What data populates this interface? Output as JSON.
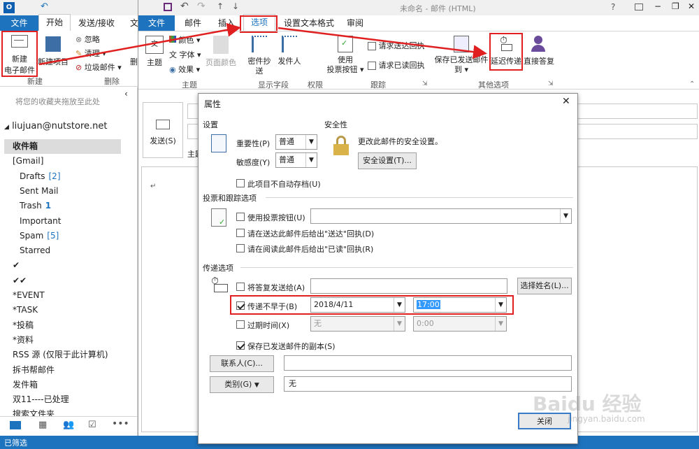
{
  "left_window": {
    "tabs": {
      "file": "文件",
      "home": "开始",
      "send_receive": "发送/接收",
      "more": "文"
    },
    "ribbon": {
      "new_email": [
        "新建",
        "电子邮件"
      ],
      "new_items": "新建项目",
      "ignore": "忽略",
      "clean": "清理",
      "junk": "垃圾邮件",
      "new_group": "新建",
      "delete_group": "删除",
      "del_small": "删"
    },
    "favorites_hint": "将您的收藏夹拖放至此处",
    "account": "liujuan@nutstore.net",
    "folders": [
      {
        "label": "收件箱",
        "count": "",
        "bold": true,
        "indent": 0,
        "selected": true
      },
      {
        "label": "[Gmail]",
        "count": "",
        "indent": 0
      },
      {
        "label": "Drafts",
        "count": "[2]",
        "indent": 1
      },
      {
        "label": "Sent Mail",
        "count": "",
        "indent": 1
      },
      {
        "label": "Trash",
        "count": "1",
        "indent": 1
      },
      {
        "label": "Important",
        "count": "",
        "indent": 1
      },
      {
        "label": "Spam",
        "count": "[5]",
        "indent": 1
      },
      {
        "label": "Starred",
        "count": "",
        "indent": 1
      },
      {
        "label": "✔",
        "count": "",
        "indent": 0
      },
      {
        "label": "✔✔",
        "count": "",
        "indent": 0
      },
      {
        "label": "*EVENT",
        "count": "",
        "indent": 0
      },
      {
        "label": "*TASK",
        "count": "",
        "indent": 0
      },
      {
        "label": "*投稿",
        "count": "",
        "indent": 0
      },
      {
        "label": "*资料",
        "count": "",
        "indent": 0
      },
      {
        "label": "RSS 源 (仅限于此计算机)",
        "count": "",
        "indent": 0
      },
      {
        "label": "拆书帮邮件",
        "count": "",
        "indent": 0
      },
      {
        "label": "发件箱",
        "count": "",
        "indent": 0
      },
      {
        "label": "双11----已处理",
        "count": "",
        "indent": 0
      },
      {
        "label": "搜索文件夹",
        "count": "",
        "indent": 0
      }
    ],
    "status": "已筛选"
  },
  "compose": {
    "title": "未命名 - 邮件 (HTML)",
    "tabs": [
      "文件",
      "邮件",
      "插入",
      "选项",
      "设置文本格式",
      "审阅"
    ],
    "groups": {
      "theme": "主题",
      "show_fields": "显示字段",
      "permissions": "权限",
      "tracking": "跟踪",
      "more_options": "其他选项"
    },
    "buttons": {
      "themes": "主题",
      "colors": "颜色",
      "fonts": "字体",
      "effects": "效果",
      "page_color": [
        "页面颜色"
      ],
      "bcc": "密件抄送",
      "from": "发件人",
      "use_voting": [
        "使用",
        "投票按钮"
      ],
      "req_delivery": "请求送达回执",
      "req_read": "请求已读回执",
      "save_sent": [
        "保存已发送邮件",
        "到"
      ],
      "delay": "延迟传递",
      "direct": "直接答复"
    },
    "send": "发送(S)",
    "subject_label": "主题",
    "body_mark": "↵"
  },
  "dialog": {
    "title": "属性",
    "settings": "设置",
    "importance_label": "重要性(P)",
    "importance": "普通",
    "sensitivity_label": "敏感度(Y)",
    "sensitivity": "普通",
    "no_autoarchive": "此项目不自动存档(U)",
    "security": "安全性",
    "security_text": "更改此邮件的安全设置。",
    "security_btn": "安全设置(T)...",
    "voting_section": "投票和跟踪选项",
    "use_voting": "使用投票按钮(U)",
    "delivery_receipt": "请在送达此邮件后给出\"送达\"回执(D)",
    "read_receipt": "请在阅读此邮件后给出\"已读\"回执(R)",
    "delivery_section": "传递选项",
    "reply_to": "将答复发送给(A)",
    "select_names": "选择姓名(L)...",
    "no_earlier": "传递不早于(B)",
    "date": "2018/4/11",
    "time": "17:00",
    "expires": "过期时间(X)",
    "expires_date": "无",
    "expires_time": "0:00",
    "save_copy": "保存已发送邮件的副本(S)",
    "contacts": "联系人(C)...",
    "categories": "类别(G)",
    "categories_value": "无",
    "close": "关闭"
  },
  "watermark": "Baidu 经验",
  "watermark_url": "jingyan.baidu.com"
}
